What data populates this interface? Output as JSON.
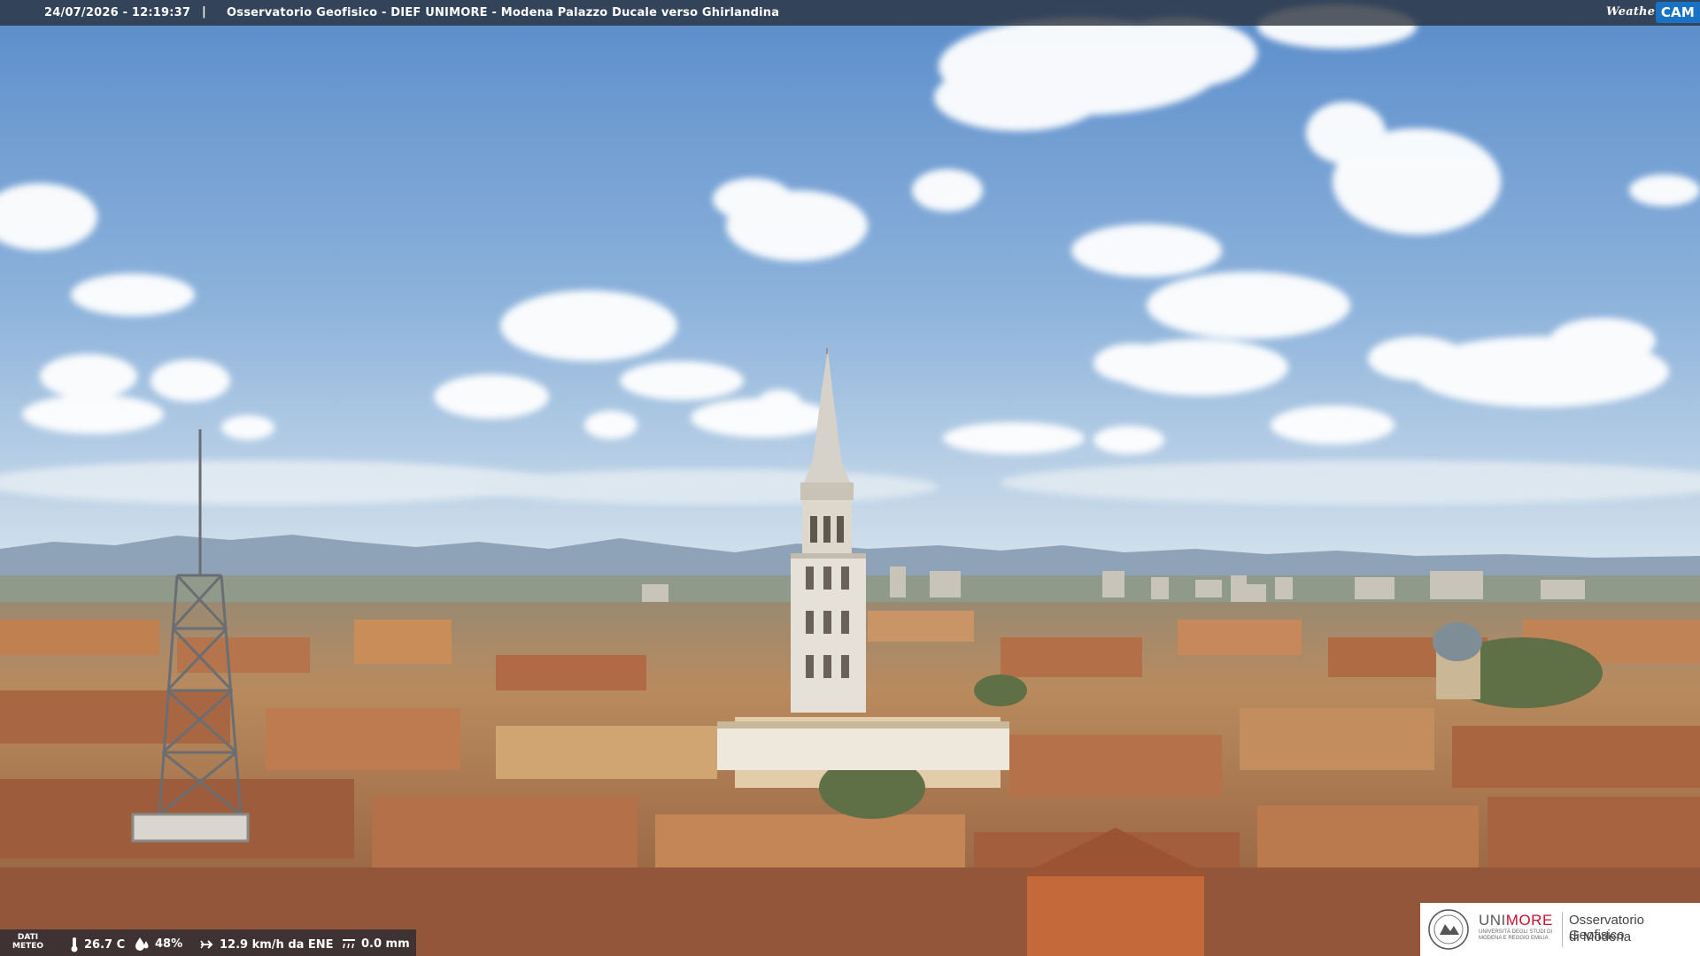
{
  "overlay": {
    "timestamp": "24/07/2026 - 12:19:37",
    "separator": "|",
    "title": "Osservatorio Geofisico - DIEF UNIMORE - Modena Palazzo Ducale verso Ghirlandina"
  },
  "brand": {
    "weather": "Weather",
    "cam": "CAM"
  },
  "meteo": {
    "label_line1": "DATI",
    "label_line2": "METEO",
    "temperature": "26.7 C",
    "humidity": "48%",
    "wind": "12.9 km/h da ENE",
    "rain": "0.0 mm"
  },
  "institution": {
    "uni": "UNI",
    "more": "MORE",
    "uni_full": "UNIVERSITÀ DEGLI STUDI DI MODENA E REGGIO EMILIA",
    "observatory_line1": "Osservatorio Geofisico",
    "observatory_line2": "di Modena"
  },
  "scene": {
    "sky_top": "#5e90cc",
    "sky_bottom": "#c9dcea",
    "mountains": "#8ea4ba",
    "roof": "#b9744b",
    "wall": "#d8b07c"
  }
}
